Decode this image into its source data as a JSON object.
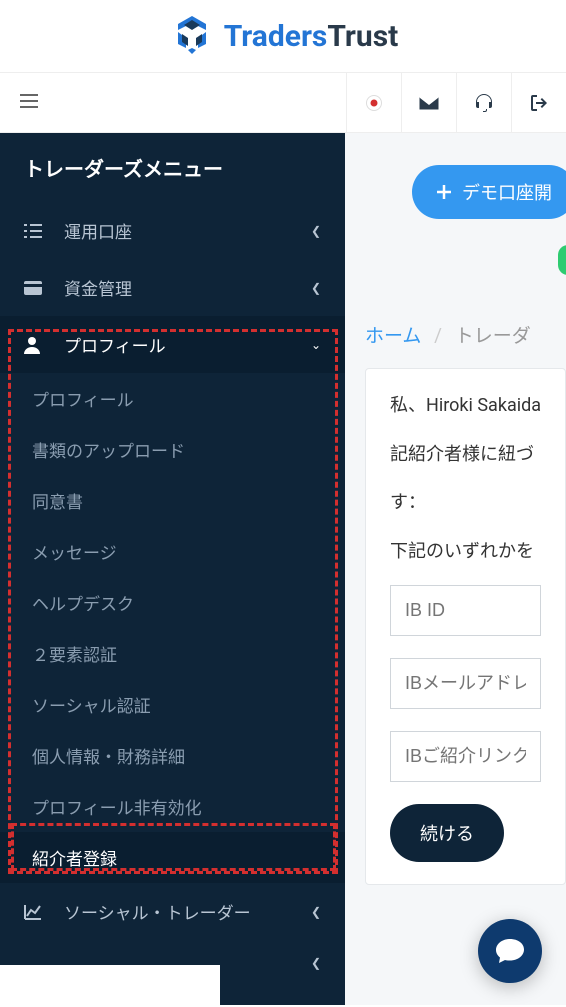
{
  "logo": {
    "text1": "Traders",
    "text2": "Trust"
  },
  "sidebar": {
    "title": "トレーダーズメニュー",
    "items": [
      {
        "label": "運用口座"
      },
      {
        "label": "資金管理"
      },
      {
        "label": "プロフィール"
      },
      {
        "label": "ソーシャル・トレーダー"
      }
    ]
  },
  "submenu": {
    "items": [
      {
        "label": "プロフィール"
      },
      {
        "label": "書類のアップロード"
      },
      {
        "label": "同意書"
      },
      {
        "label": "メッセージ"
      },
      {
        "label": "ヘルプデスク"
      },
      {
        "label": "２要素認証"
      },
      {
        "label": "ソーシャル認証"
      },
      {
        "label": "個人情報・財務詳細"
      },
      {
        "label": "プロフィール非有効化"
      },
      {
        "label": "紹介者登録"
      }
    ]
  },
  "demo_button": "デモ口座開",
  "breadcrumb": {
    "home": "ホーム",
    "current": "トレーダ"
  },
  "card": {
    "line1": "私、Hiroki Sakaida",
    "line2": "記紹介者様に紐づ",
    "line3": "す：",
    "line4": "下記のいずれかを",
    "input1": "IB ID",
    "input2": "IBメールアドレス",
    "input3": "IBご紹介リンク",
    "continue": "続ける"
  }
}
